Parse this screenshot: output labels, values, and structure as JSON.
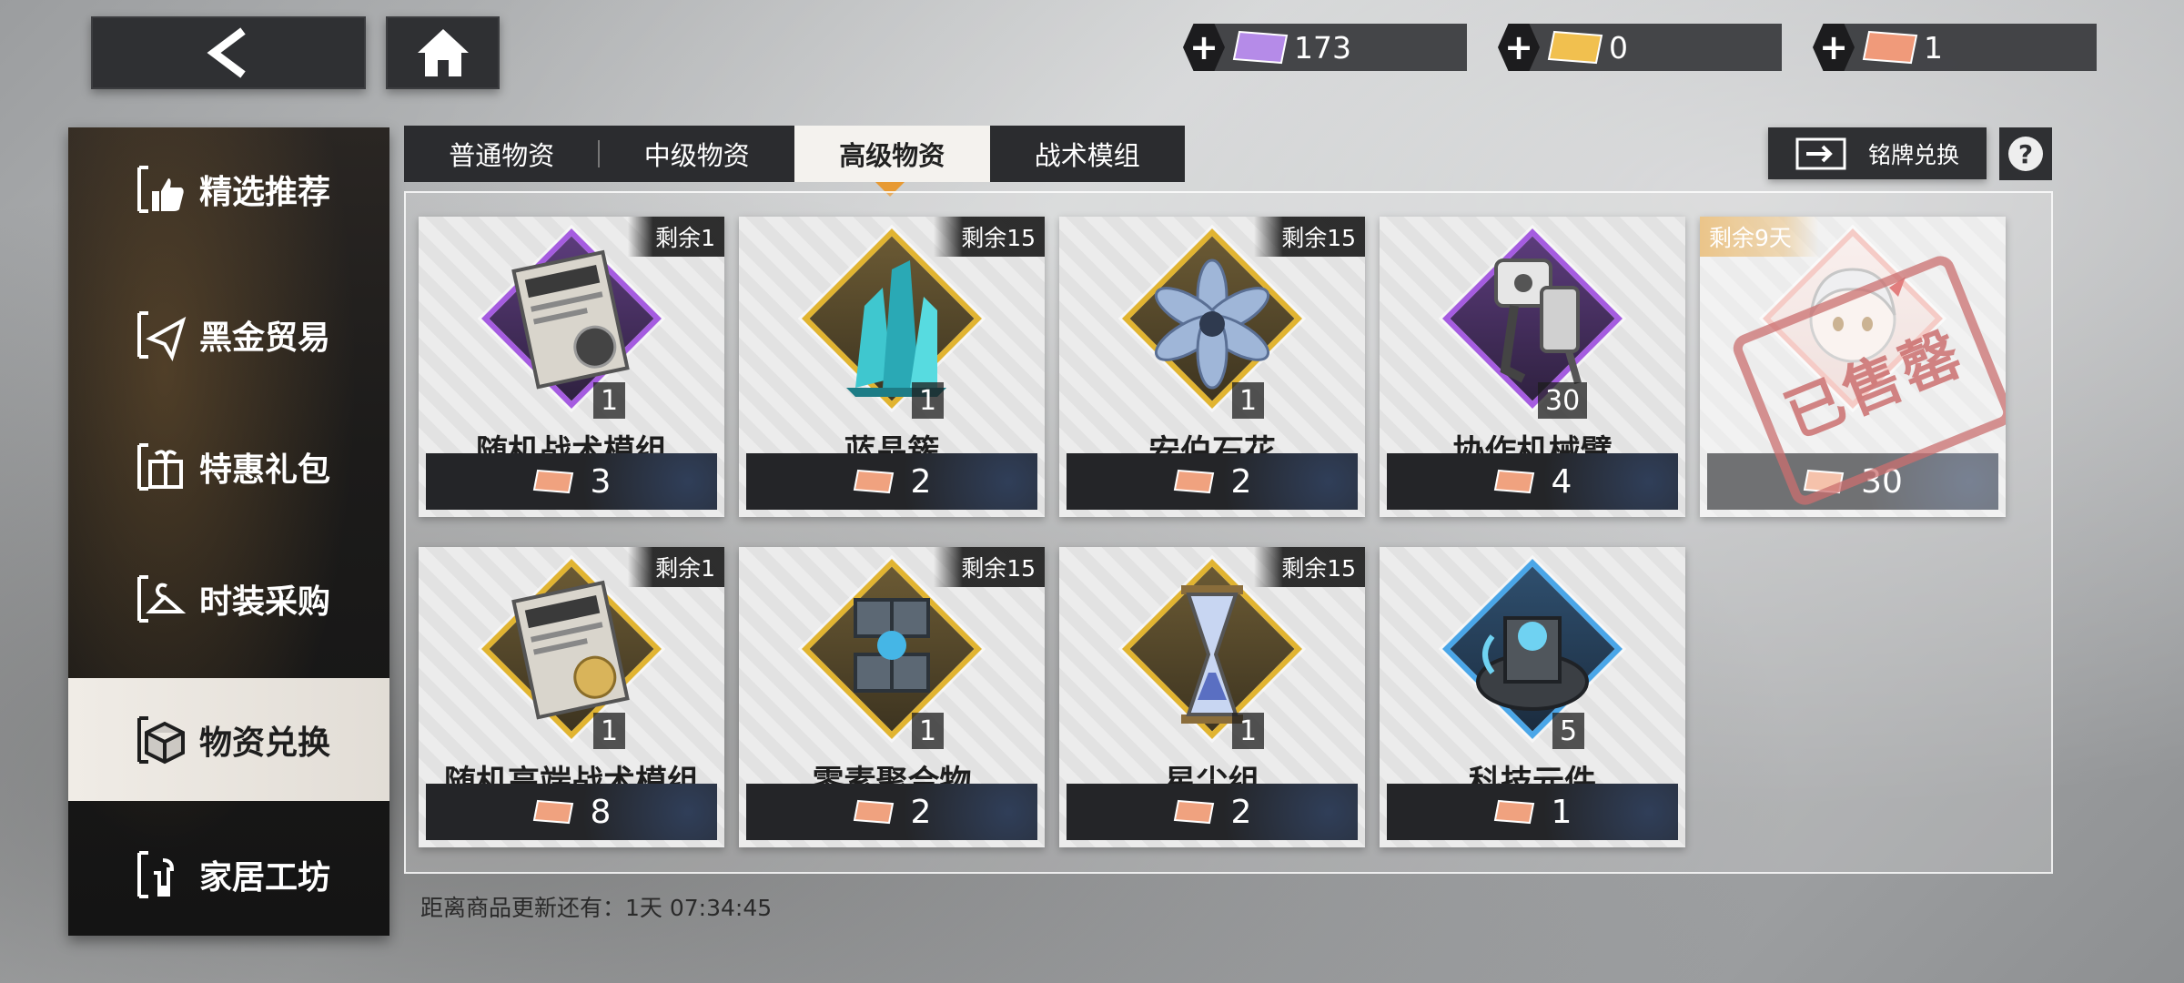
{
  "currencies": [
    {
      "value": "173",
      "color": "#b58be8"
    },
    {
      "value": "0",
      "color": "#f1c04f"
    },
    {
      "value": "1",
      "color": "#f09a7a"
    }
  ],
  "sidebar": {
    "items": [
      {
        "label": "精选推荐"
      },
      {
        "label": "黑金贸易"
      },
      {
        "label": "特惠礼包"
      },
      {
        "label": "时装采购"
      },
      {
        "label": "物资兑换"
      },
      {
        "label": "家居工坊"
      }
    ]
  },
  "tabs": [
    {
      "label": "普通物资"
    },
    {
      "label": "中级物资"
    },
    {
      "label": "高级物资"
    },
    {
      "label": "战术模组"
    }
  ],
  "badge_exchange": {
    "label": "铭牌兑换"
  },
  "help": {
    "label": "?"
  },
  "items": [
    {
      "name": "随机战术模组",
      "stock": "剩余1",
      "qty": "1",
      "price": "3",
      "rarity": "purple"
    },
    {
      "name": "蓝晶簇",
      "stock": "剩余15",
      "qty": "1",
      "price": "2",
      "rarity": "gold"
    },
    {
      "name": "安伯石花",
      "stock": "剩余15",
      "qty": "1",
      "price": "2",
      "rarity": "gold"
    },
    {
      "name": "协作机械臂",
      "stock": "",
      "qty": "30",
      "price": "4",
      "rarity": "purple"
    },
    {
      "name": "",
      "stock": "剩余9天",
      "qty": "",
      "price": "30",
      "rarity": "pink",
      "sold_out_stamp": "已售罄"
    },
    {
      "name": "随机高端战术模组",
      "stock": "剩余1",
      "qty": "1",
      "price": "8",
      "rarity": "gold"
    },
    {
      "name": "零素聚合物",
      "stock": "剩余15",
      "qty": "1",
      "price": "2",
      "rarity": "gold"
    },
    {
      "name": "星尘组",
      "stock": "剩余15",
      "qty": "1",
      "price": "2",
      "rarity": "gold"
    },
    {
      "name": "科技元件",
      "stock": "",
      "qty": "5",
      "price": "1",
      "rarity": "blue"
    }
  ],
  "refresh_text": "距离商品更新还有：1天 07:34:45"
}
